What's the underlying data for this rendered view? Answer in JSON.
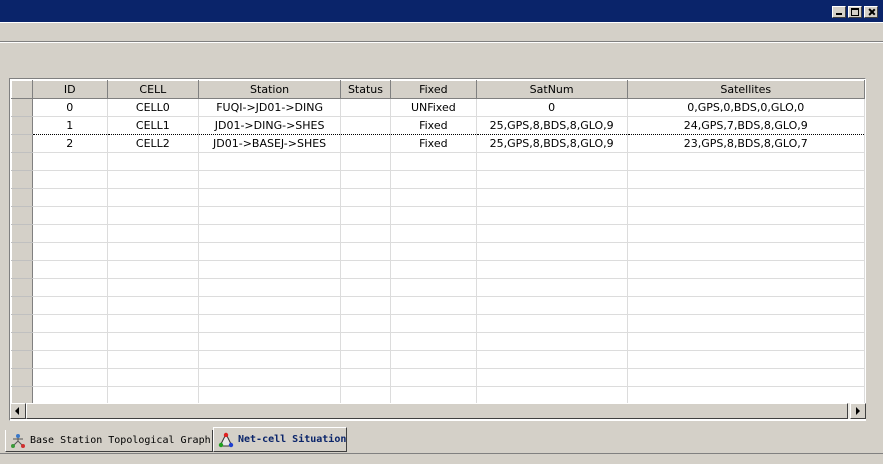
{
  "window": {
    "controls": [
      "minimize",
      "maximize",
      "close"
    ]
  },
  "grid": {
    "columns": [
      "ID",
      "CELL",
      "Station",
      "Status",
      "Fixed",
      "SatNum",
      "Satellites"
    ],
    "rows": [
      {
        "id": "0",
        "cell": "CELL0",
        "station": "FUQI->JD01->DING",
        "status": "",
        "fixed": "UNFixed",
        "satnum": "0",
        "satellites": "0,GPS,0,BDS,0,GLO,0"
      },
      {
        "id": "1",
        "cell": "CELL1",
        "station": "JD01->DING->SHES",
        "status": "",
        "fixed": "Fixed",
        "satnum": "25,GPS,8,BDS,8,GLO,9",
        "satellites": "24,GPS,7,BDS,8,GLO,9"
      },
      {
        "id": "2",
        "cell": "CELL2",
        "station": "JD01->BASEJ->SHES",
        "status": "",
        "fixed": "Fixed",
        "satnum": "25,GPS,8,BDS,8,GLO,9",
        "satellites": "23,GPS,8,BDS,8,GLO,7"
      }
    ]
  },
  "tabs": [
    {
      "label": "Base Station Topological Graph",
      "icon": "topology-graph-icon",
      "active": false
    },
    {
      "label": "Net-cell Situation",
      "icon": "triangle-network-icon",
      "active": true
    }
  ],
  "colors": {
    "titlebar": "#0a246a",
    "face": "#d4d0c8",
    "grid_line": "#dcdcdc"
  }
}
